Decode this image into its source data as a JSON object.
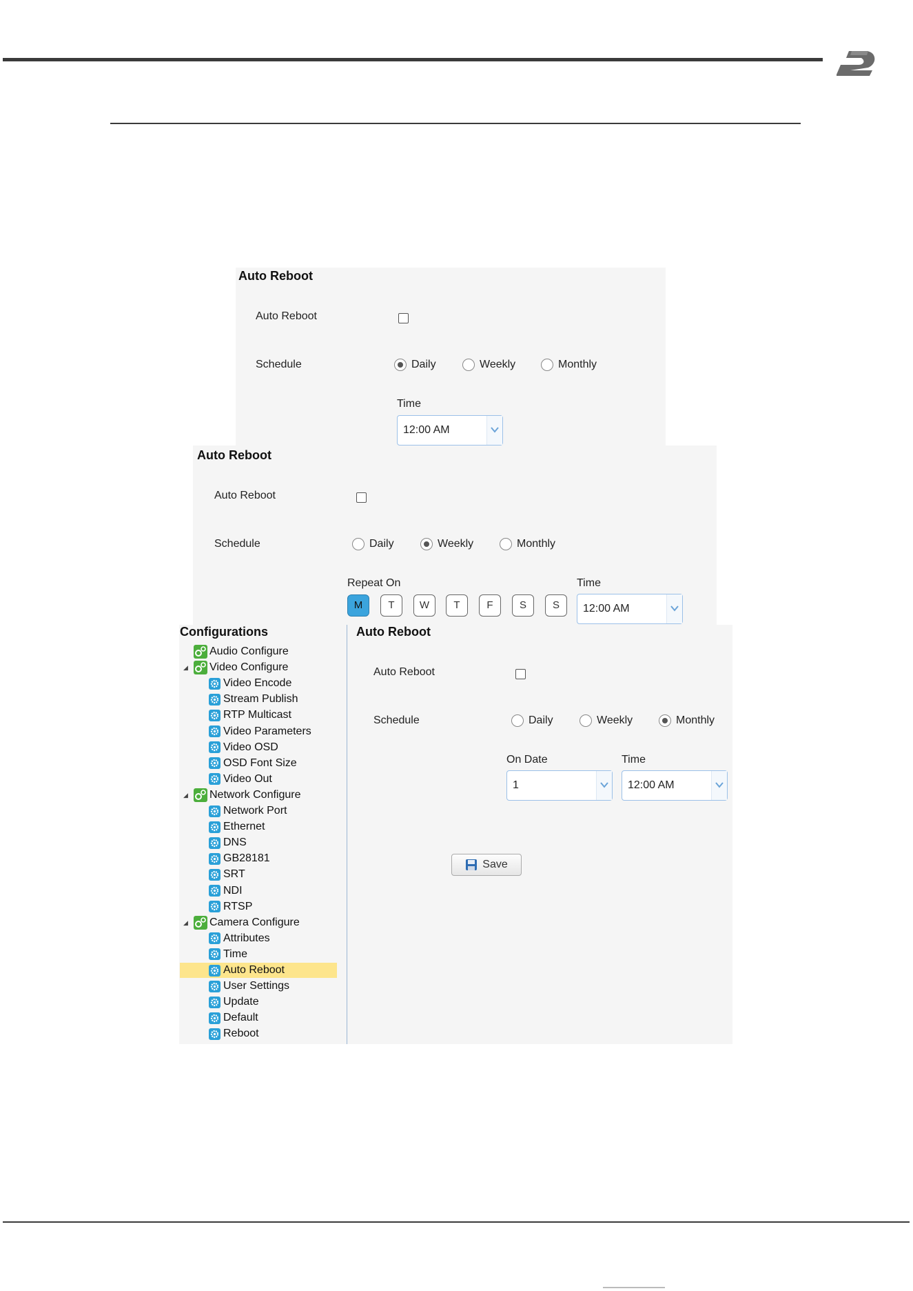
{
  "colors": {
    "accent": "#3ba4dd",
    "highlight": "#fde58c",
    "panel_bg": "#f5f5f5"
  },
  "panel1": {
    "title": "Auto Reboot",
    "auto_reboot_label": "Auto Reboot",
    "schedule_label": "Schedule",
    "options": [
      "Daily",
      "Weekly",
      "Monthly"
    ],
    "selected": "Daily",
    "time_label": "Time",
    "time_value": "12:00 AM"
  },
  "panel2": {
    "title": "Auto Reboot",
    "auto_reboot_label": "Auto Reboot",
    "schedule_label": "Schedule",
    "options": [
      "Daily",
      "Weekly",
      "Monthly"
    ],
    "selected": "Weekly",
    "repeat_label": "Repeat On",
    "days": [
      "M",
      "T",
      "W",
      "T",
      "F",
      "S",
      "S"
    ],
    "selected_day": "M",
    "time_label": "Time",
    "time_value": "12:00 AM"
  },
  "panel3": {
    "sidebar": {
      "title": "Configurations",
      "groups": [
        {
          "label": "Audio Configure",
          "items": []
        },
        {
          "label": "Video Configure",
          "items": [
            "Video Encode",
            "Stream Publish",
            "RTP Multicast",
            "Video Parameters",
            "Video OSD",
            "OSD Font Size",
            "Video Out"
          ]
        },
        {
          "label": "Network Configure",
          "items": [
            "Network Port",
            "Ethernet",
            "DNS",
            "GB28181",
            "SRT",
            "NDI",
            "RTSP"
          ]
        },
        {
          "label": "Camera Configure",
          "items": [
            "Attributes",
            "Time",
            "Auto Reboot",
            "User Settings",
            "Update",
            "Default",
            "Reboot"
          ]
        }
      ],
      "selected_item": "Auto Reboot"
    },
    "title": "Auto Reboot",
    "auto_reboot_label": "Auto Reboot",
    "schedule_label": "Schedule",
    "options": [
      "Daily",
      "Weekly",
      "Monthly"
    ],
    "selected": "Monthly",
    "on_date_label": "On Date",
    "on_date_value": "1",
    "time_label": "Time",
    "time_value": "12:00 AM",
    "save_label": "Save"
  }
}
